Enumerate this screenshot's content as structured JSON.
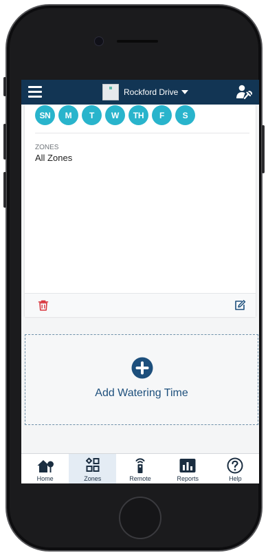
{
  "header": {
    "location_name": "Rockford Drive"
  },
  "schedule": {
    "days": [
      "SN",
      "M",
      "T",
      "W",
      "TH",
      "F",
      "S"
    ],
    "zones_label": "ZONES",
    "zones_value": "All Zones"
  },
  "add_watering": {
    "label": "Add Watering Time"
  },
  "tabs": [
    {
      "label": "Home",
      "icon": "home-icon"
    },
    {
      "label": "Zones",
      "icon": "zones-icon",
      "active": true
    },
    {
      "label": "Remote",
      "icon": "remote-icon"
    },
    {
      "label": "Reports",
      "icon": "reports-icon"
    },
    {
      "label": "Help",
      "icon": "help-icon"
    }
  ],
  "colors": {
    "header_bg": "#123554",
    "day_circle": "#29b4cc",
    "delete_red": "#d9363e",
    "accent_blue": "#1d4f7c"
  }
}
